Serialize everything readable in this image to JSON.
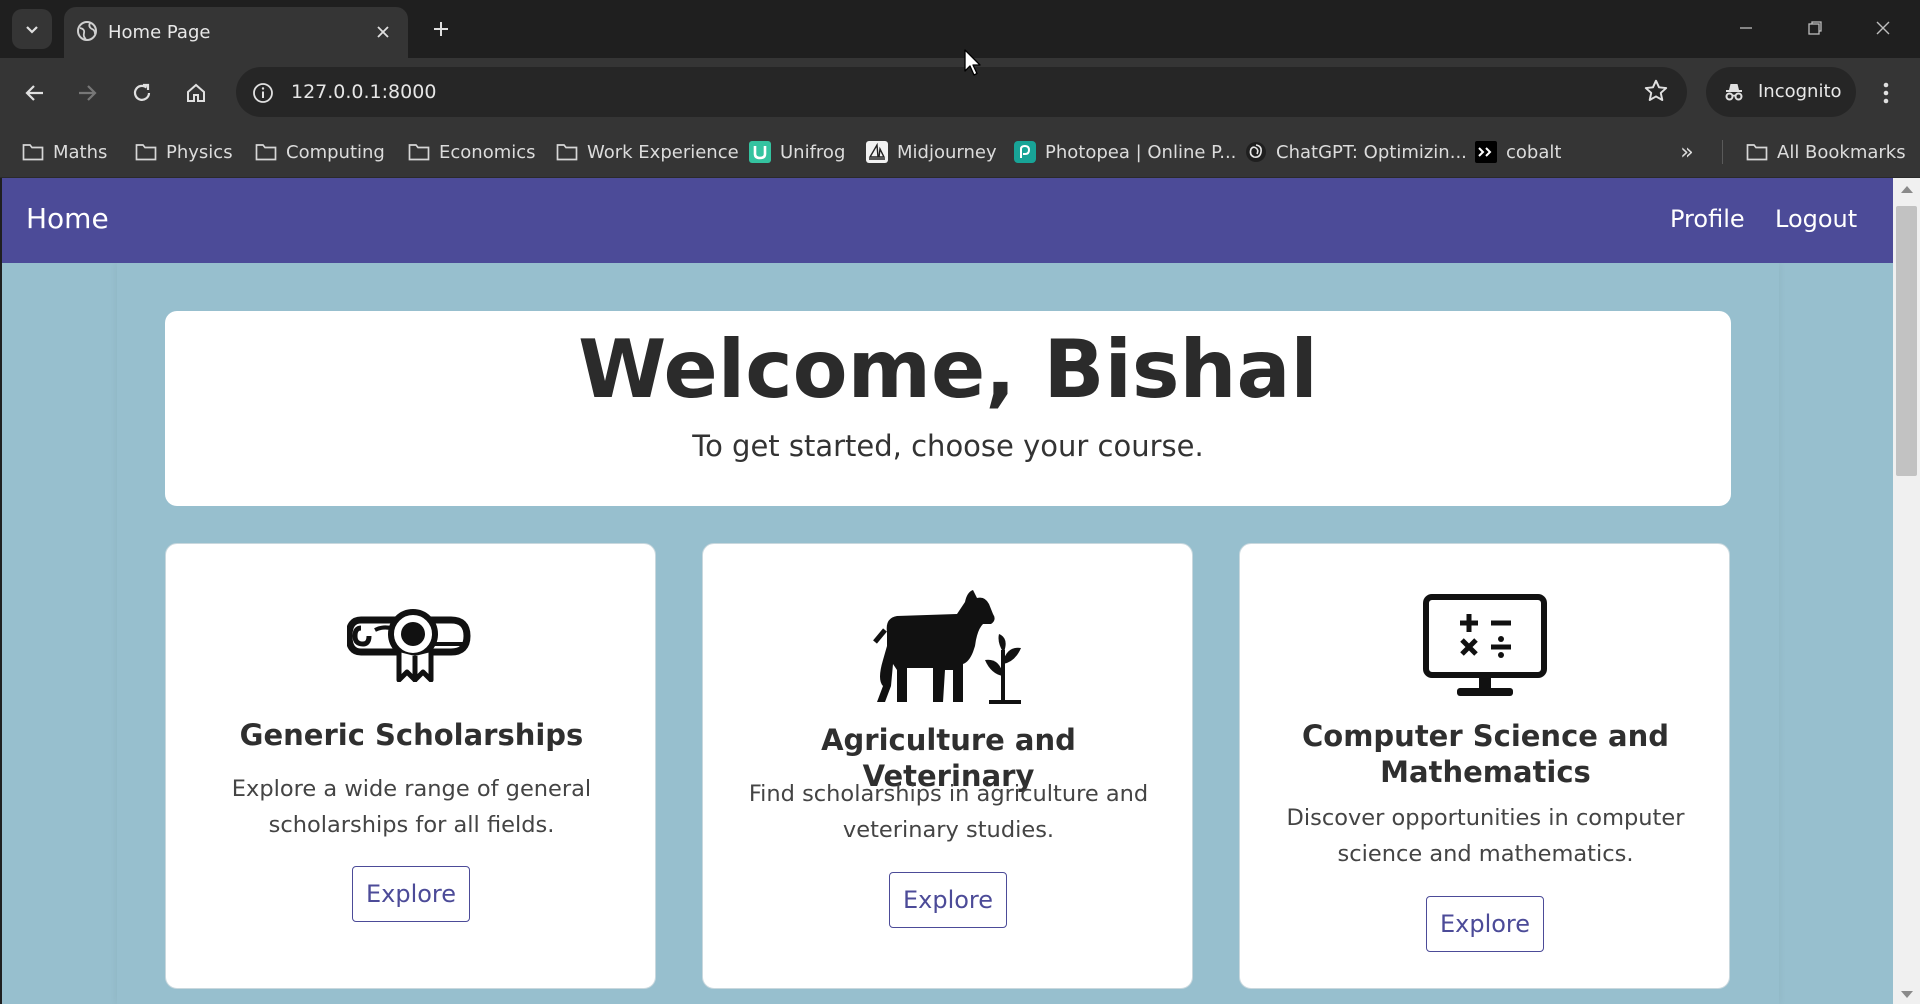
{
  "browser": {
    "tab_title": "Home Page",
    "url": "127.0.0.1:8000",
    "profile_label": "Incognito",
    "icons": {
      "tab_search": "chevron-down-icon",
      "tab_favicon": "globe-icon",
      "tab_close": "close-icon",
      "new_tab": "plus-icon",
      "back": "arrow-left-icon",
      "forward": "arrow-right-icon",
      "reload": "reload-icon",
      "home": "home-icon",
      "site_info": "info-icon",
      "bookmark_star": "star-icon",
      "menu": "kebab-icon"
    },
    "bookmarks": [
      {
        "label": "Maths",
        "icon": "folder-icon"
      },
      {
        "label": "Physics",
        "icon": "folder-icon"
      },
      {
        "label": "Computing",
        "icon": "folder-icon"
      },
      {
        "label": "Economics",
        "icon": "folder-icon"
      },
      {
        "label": "Work Experience",
        "icon": "folder-icon"
      },
      {
        "label": "Unifrog",
        "icon": "unifrog-icon"
      },
      {
        "label": "Midjourney",
        "icon": "midjourney-icon"
      },
      {
        "label": "Photopea | Online P...",
        "icon": "photopea-icon"
      },
      {
        "label": "ChatGPT: Optimizin...",
        "icon": "chatgpt-icon"
      },
      {
        "label": "cobalt",
        "icon": "cobalt-icon"
      }
    ],
    "more_bookmarks": "»",
    "all_bookmarks": "All Bookmarks"
  },
  "page": {
    "navbar": {
      "brand": "Home",
      "links": [
        "Profile",
        "Logout"
      ],
      "bg_color": "#4c4b98"
    },
    "welcome": {
      "heading": "Welcome, Bishal",
      "subheading": "To get started, choose your course."
    },
    "cards": [
      {
        "icon": "scholarship-certificate-icon",
        "title": "Generic Scholarships",
        "description": "Explore a wide range of general scholarships for all fields.",
        "button": "Explore"
      },
      {
        "icon": "goat-plant-icon",
        "title": "Agriculture and Veterinary",
        "description": "Find scholarships in agriculture and veterinary studies.",
        "button": "Explore"
      },
      {
        "icon": "calculator-monitor-icon",
        "title": "Computer Science and Mathematics",
        "description": "Discover opportunities in computer science and mathematics.",
        "button": "Explore"
      }
    ],
    "colors": {
      "background": "#97bfce",
      "accent": "#4c4b98"
    }
  }
}
